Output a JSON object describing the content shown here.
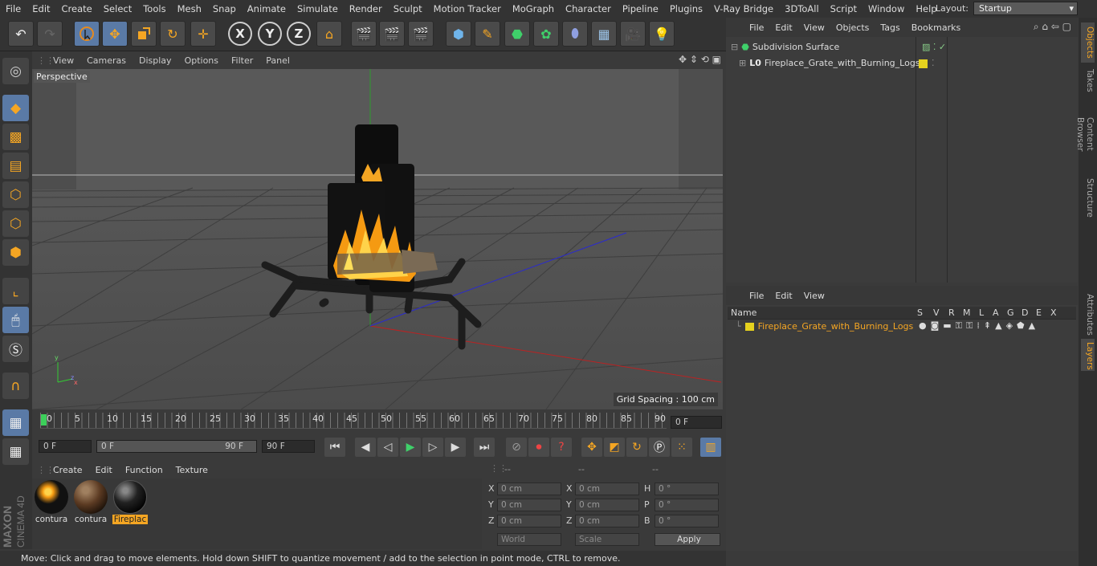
{
  "menu": [
    "File",
    "Edit",
    "Create",
    "Select",
    "Tools",
    "Mesh",
    "Snap",
    "Animate",
    "Simulate",
    "Render",
    "Sculpt",
    "Motion Tracker",
    "MoGraph",
    "Character",
    "Pipeline",
    "Plugins",
    "V-Ray Bridge",
    "3DToAll",
    "Script",
    "Window",
    "Help"
  ],
  "layout": {
    "label": "Layout:",
    "value": "Startup"
  },
  "viewport": {
    "menu": [
      "View",
      "Cameras",
      "Display",
      "Options",
      "Filter",
      "Panel"
    ],
    "label": "Perspective",
    "grid_spacing": "Grid Spacing : 100 cm"
  },
  "timeline": {
    "ticks": [
      "0",
      "5",
      "10",
      "15",
      "20",
      "25",
      "30",
      "35",
      "40",
      "45",
      "50",
      "55",
      "60",
      "65",
      "70",
      "75",
      "80",
      "85",
      "90"
    ],
    "current": "0 F"
  },
  "transport": {
    "start": "0 F",
    "range_start": "0 F",
    "range_end": "90 F",
    "end": "90 F"
  },
  "materials": {
    "menu": [
      "Create",
      "Edit",
      "Function",
      "Texture"
    ],
    "items": [
      {
        "label": "contura"
      },
      {
        "label": "contura"
      },
      {
        "label": "Fireplac"
      }
    ]
  },
  "coords": {
    "dashes": [
      "--",
      "--",
      "--"
    ],
    "rows": [
      {
        "a": "X",
        "av": "0 cm",
        "b": "X",
        "bv": "0 cm",
        "c": "H",
        "cv": "0 °"
      },
      {
        "a": "Y",
        "av": "0 cm",
        "b": "Y",
        "bv": "0 cm",
        "c": "P",
        "cv": "0 °"
      },
      {
        "a": "Z",
        "av": "0 cm",
        "b": "Z",
        "bv": "0 cm",
        "c": "B",
        "cv": "0 °"
      }
    ],
    "world": "World",
    "scale": "Scale",
    "apply": "Apply"
  },
  "status": "Move: Click and drag to move elements. Hold down SHIFT to quantize movement / add to the selection in point mode, CTRL to remove.",
  "objects": {
    "menu": [
      "File",
      "Edit",
      "View",
      "Objects",
      "Tags",
      "Bookmarks"
    ],
    "items": [
      "Subdivision Surface",
      "Fireplace_Grate_with_Burning_Logs"
    ]
  },
  "layers": {
    "menu": [
      "File",
      "Edit",
      "View"
    ],
    "columns": [
      "Name",
      "S",
      "V",
      "R",
      "M",
      "L",
      "A",
      "G",
      "D",
      "E",
      "X"
    ],
    "items": [
      "Fireplace_Grate_with_Burning_Logs"
    ]
  },
  "side_tabs": [
    "Objects",
    "Takes",
    "Content Browser",
    "Structure",
    "Attributes",
    "Layers"
  ],
  "logo": {
    "brand": "MAXON",
    "product": "CINEMA 4D"
  },
  "colors": {
    "accent": "#f5a623",
    "selected": "#5a7aa6",
    "layer_yellow": "#e6d21e"
  }
}
